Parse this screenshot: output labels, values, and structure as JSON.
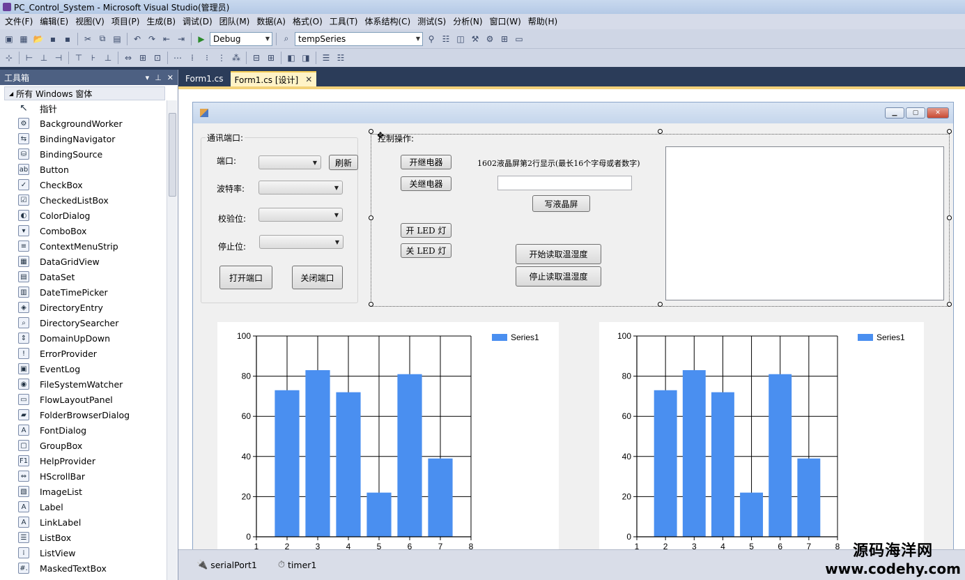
{
  "window": {
    "title": "PC_Control_System - Microsoft Visual Studio(管理员)"
  },
  "menubar": [
    "文件(F)",
    "编辑(E)",
    "视图(V)",
    "项目(P)",
    "生成(B)",
    "调试(D)",
    "团队(M)",
    "数据(A)",
    "格式(O)",
    "工具(T)",
    "体系结构(C)",
    "测试(S)",
    "分析(N)",
    "窗口(W)",
    "帮助(H)"
  ],
  "toolbar": {
    "config": "Debug",
    "project_combo": "tempSeries"
  },
  "toolbox": {
    "title": "工具箱",
    "header_buttons": [
      "▾",
      "⊥",
      "✕"
    ],
    "section": "所有 Windows 窗体",
    "items": [
      {
        "label": "指针",
        "icon": "pointer-icon",
        "glyph": "↖"
      },
      {
        "label": "BackgroundWorker",
        "icon": "backgroundworker-icon",
        "glyph": "⚙"
      },
      {
        "label": "BindingNavigator",
        "icon": "bindingnavigator-icon",
        "glyph": "⇆"
      },
      {
        "label": "BindingSource",
        "icon": "bindingsource-icon",
        "glyph": "⛁"
      },
      {
        "label": "Button",
        "icon": "button-icon",
        "glyph": "ab"
      },
      {
        "label": "CheckBox",
        "icon": "checkbox-icon",
        "glyph": "✓"
      },
      {
        "label": "CheckedListBox",
        "icon": "checkedlistbox-icon",
        "glyph": "☑"
      },
      {
        "label": "ColorDialog",
        "icon": "colordialog-icon",
        "glyph": "◐"
      },
      {
        "label": "ComboBox",
        "icon": "combobox-icon",
        "glyph": "▾"
      },
      {
        "label": "ContextMenuStrip",
        "icon": "contextmenustrip-icon",
        "glyph": "≡"
      },
      {
        "label": "DataGridView",
        "icon": "datagridview-icon",
        "glyph": "▦"
      },
      {
        "label": "DataSet",
        "icon": "dataset-icon",
        "glyph": "▤"
      },
      {
        "label": "DateTimePicker",
        "icon": "datetimepicker-icon",
        "glyph": "▥"
      },
      {
        "label": "DirectoryEntry",
        "icon": "directoryentry-icon",
        "glyph": "◈"
      },
      {
        "label": "DirectorySearcher",
        "icon": "directorysearcher-icon",
        "glyph": "⌕"
      },
      {
        "label": "DomainUpDown",
        "icon": "domainupdown-icon",
        "glyph": "⇕"
      },
      {
        "label": "ErrorProvider",
        "icon": "errorprovider-icon",
        "glyph": "!"
      },
      {
        "label": "EventLog",
        "icon": "eventlog-icon",
        "glyph": "▣"
      },
      {
        "label": "FileSystemWatcher",
        "icon": "filesystemwatcher-icon",
        "glyph": "◉"
      },
      {
        "label": "FlowLayoutPanel",
        "icon": "flowlayoutpanel-icon",
        "glyph": "▭"
      },
      {
        "label": "FolderBrowserDialog",
        "icon": "folderbrowserdialog-icon",
        "glyph": "▰"
      },
      {
        "label": "FontDialog",
        "icon": "fontdialog-icon",
        "glyph": "A"
      },
      {
        "label": "GroupBox",
        "icon": "groupbox-icon",
        "glyph": "▢"
      },
      {
        "label": "HelpProvider",
        "icon": "helpprovider-icon",
        "glyph": "F1"
      },
      {
        "label": "HScrollBar",
        "icon": "hscrollbar-icon",
        "glyph": "⇔"
      },
      {
        "label": "ImageList",
        "icon": "imagelist-icon",
        "glyph": "▧"
      },
      {
        "label": "Label",
        "icon": "label-icon",
        "glyph": "A"
      },
      {
        "label": "LinkLabel",
        "icon": "linklabel-icon",
        "glyph": "A"
      },
      {
        "label": "ListBox",
        "icon": "listbox-icon",
        "glyph": "☰"
      },
      {
        "label": "ListView",
        "icon": "listview-icon",
        "glyph": "⁞"
      },
      {
        "label": "MaskedTextBox",
        "icon": "maskedtextbox-icon",
        "glyph": "#."
      }
    ]
  },
  "doc_tabs": [
    {
      "label": "Form1.cs",
      "active": false
    },
    {
      "label": "Form1.cs [设计]",
      "active": true
    }
  ],
  "form": {
    "comm_group": {
      "title": "通讯端口:",
      "port_label": "端口:",
      "refresh_button": "刷新",
      "baud_label": "波特率:",
      "parity_label": "校验位:",
      "stopbits_label": "停止位:",
      "open_button": "打开端口",
      "close_button": "关闭端口"
    },
    "control_group": {
      "title": "控制操作:",
      "relay_on": "开继电器",
      "relay_off": "关继电器",
      "led_on": "开 LED 灯",
      "led_off": "关 LED 灯",
      "lcd_caption": "1602液晶屏第2行显示(最长16个字母或者数字)",
      "lcd_input": "",
      "write_lcd": "写液晶屏",
      "start_read": "开始读取温湿度",
      "stop_read": "停止读取温湿度"
    }
  },
  "chart_data": [
    {
      "type": "bar",
      "x": [
        2,
        3,
        4,
        5,
        6,
        7
      ],
      "series": [
        {
          "name": "Series1",
          "values": [
            73,
            83,
            72,
            22,
            81,
            39
          ],
          "color": "#4a8ff0"
        }
      ],
      "xlim": [
        1,
        8
      ],
      "ylim": [
        0,
        100
      ],
      "xticks": [
        1,
        2,
        3,
        4,
        5,
        6,
        7,
        8
      ],
      "yticks": [
        0,
        20,
        40,
        60,
        80,
        100
      ],
      "grid": true,
      "legend": "top-right"
    },
    {
      "type": "bar",
      "x": [
        2,
        3,
        4,
        5,
        6,
        7
      ],
      "series": [
        {
          "name": "Series1",
          "values": [
            73,
            83,
            72,
            22,
            81,
            39
          ],
          "color": "#4a8ff0"
        }
      ],
      "xlim": [
        1,
        8
      ],
      "ylim": [
        0,
        100
      ],
      "xticks": [
        1,
        2,
        3,
        4,
        5,
        6,
        7,
        8
      ],
      "yticks": [
        0,
        20,
        40,
        60,
        80,
        100
      ],
      "grid": true,
      "legend": "top-right"
    }
  ],
  "tray": [
    {
      "label": "serialPort1",
      "icon": "serialport-icon",
      "glyph": "🔌"
    },
    {
      "label": "timer1",
      "icon": "timer-icon",
      "glyph": "⏱"
    }
  ],
  "watermark": {
    "cn": "源码海洋网",
    "url": "www.codehy.com"
  }
}
